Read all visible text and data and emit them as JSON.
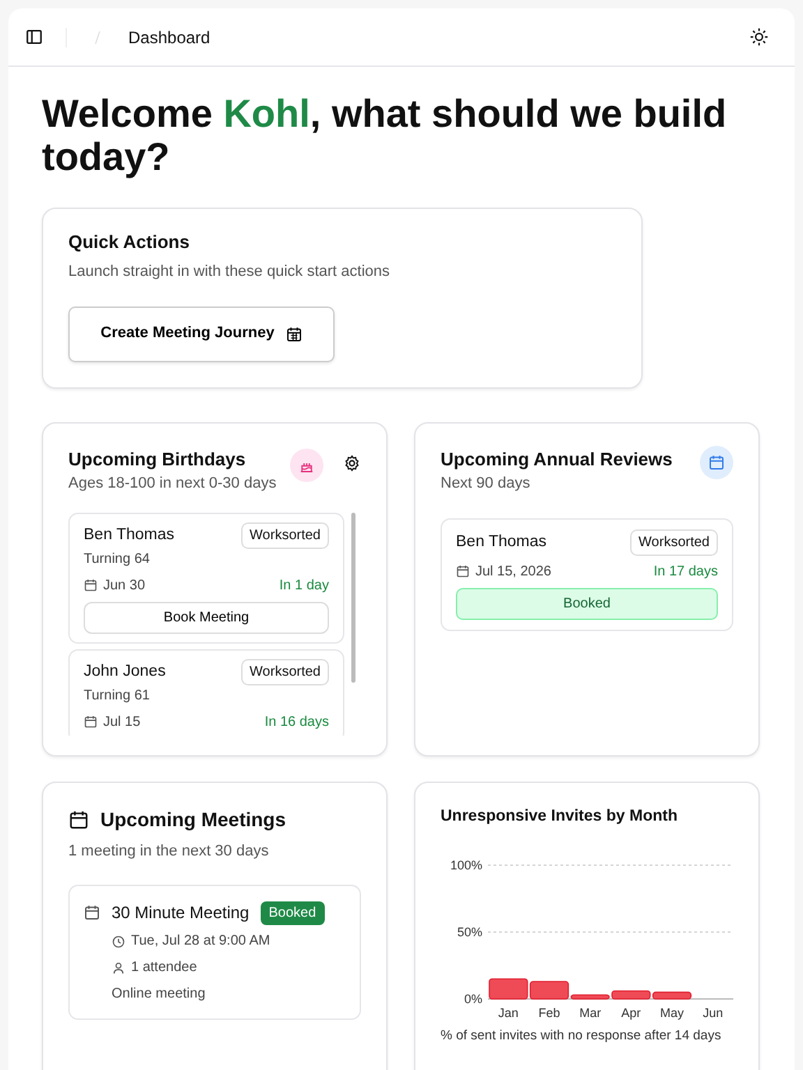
{
  "header": {
    "breadcrumb": "Dashboard"
  },
  "welcome": {
    "before": "Welcome ",
    "name": "Kohl",
    "after": ", what should we build today?"
  },
  "quick_actions": {
    "title": "Quick Actions",
    "subtitle": "Launch straight in with these quick start actions",
    "button": "Create Meeting Journey"
  },
  "birthdays": {
    "title": "Upcoming Birthdays",
    "subtitle": "Ages 18-100 in next 0-30 days",
    "items": [
      {
        "name": "Ben Thomas",
        "tag": "Worksorted",
        "detail": "Turning 64",
        "date": "Jun 30",
        "due": "In 1 day",
        "action": "Book Meeting"
      },
      {
        "name": "John Jones",
        "tag": "Worksorted",
        "detail": "Turning 61",
        "date": "Jul 15",
        "due": "In 16 days"
      }
    ]
  },
  "annual_reviews": {
    "title": "Upcoming Annual Reviews",
    "subtitle": "Next 90 days",
    "items": [
      {
        "name": "Ben Thomas",
        "tag": "Worksorted",
        "date": "Jul 15, 2026",
        "due": "In 17 days",
        "status": "Booked"
      }
    ]
  },
  "meetings": {
    "title": "Upcoming Meetings",
    "subtitle": "1 meeting in the next 30 days",
    "items": [
      {
        "title": "30 Minute Meeting",
        "status": "Booked",
        "time": "Tue, Jul 28 at 9:00 AM",
        "attendees": "1 attendee",
        "location": "Online meeting"
      }
    ]
  },
  "invites": {
    "title": "Unresponsive Invites by Month",
    "caption": "% of sent invites with no response after 14 days",
    "chart_data": {
      "type": "bar",
      "categories": [
        "Jan",
        "Feb",
        "Mar",
        "Apr",
        "May",
        "Jun"
      ],
      "series": [
        {
          "color": "#ef4b57",
          "values": [
            15,
            13,
            3,
            6,
            5,
            0
          ]
        }
      ],
      "ylim": [
        0,
        100
      ],
      "yticks": [
        {
          "value": 0,
          "label": "0%"
        },
        {
          "value": 50,
          "label": "50%"
        },
        {
          "value": 100,
          "label": "100%"
        }
      ]
    }
  }
}
